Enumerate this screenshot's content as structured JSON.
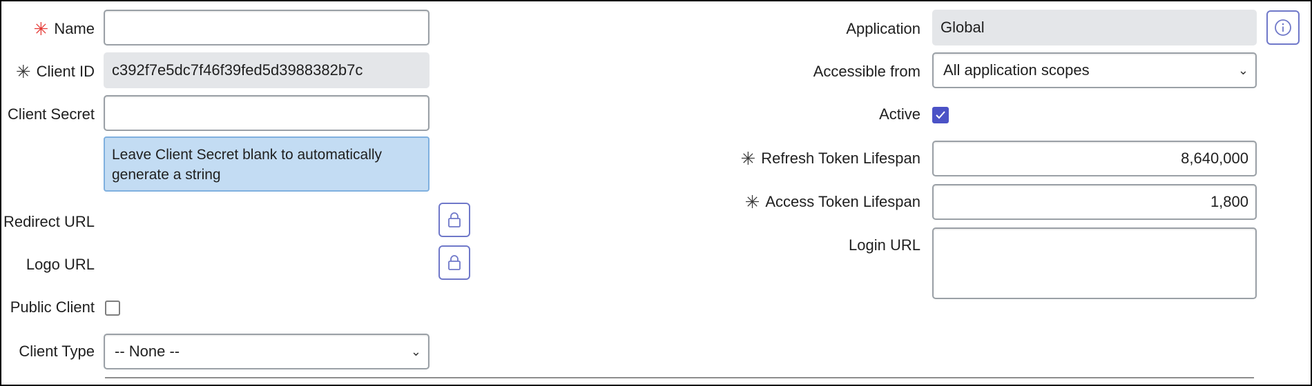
{
  "left": {
    "name": {
      "label": "Name",
      "value": ""
    },
    "client_id": {
      "label": "Client ID",
      "value": "c392f7e5dc7f46f39fed5d3988382b7c"
    },
    "client_secret": {
      "label": "Client Secret",
      "value": ""
    },
    "secret_hint": "Leave Client Secret blank to automatically generate a string",
    "redirect_url": {
      "label": "Redirect URL"
    },
    "logo_url": {
      "label": "Logo URL"
    },
    "public_client": {
      "label": "Public Client",
      "checked": false
    },
    "client_type": {
      "label": "Client Type",
      "value": "-- None --"
    }
  },
  "right": {
    "application": {
      "label": "Application",
      "value": "Global"
    },
    "accessible_from": {
      "label": "Accessible from",
      "value": "All application scopes"
    },
    "active": {
      "label": "Active",
      "checked": true
    },
    "refresh_token_lifespan": {
      "label": "Refresh Token Lifespan",
      "value": "8,640,000"
    },
    "access_token_lifespan": {
      "label": "Access Token Lifespan",
      "value": "1,800"
    },
    "login_url": {
      "label": "Login URL",
      "value": ""
    }
  },
  "icons": {
    "required": "asterisk-icon",
    "lock": "lock-icon",
    "info": "info-icon",
    "check": "checkmark-icon",
    "chevron": "chevron-down-icon"
  },
  "colors": {
    "required_red": "#e53935",
    "accent": "#4b52c6",
    "hint_bg": "#c3dcf3",
    "readonly_bg": "#e4e6e9"
  }
}
